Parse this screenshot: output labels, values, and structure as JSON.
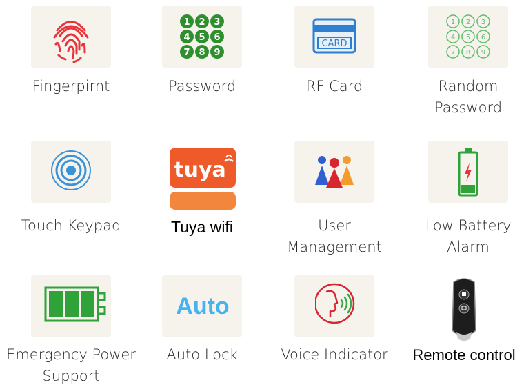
{
  "features": [
    {
      "label": "Fingerpirnt",
      "icon": "fingerprint-icon"
    },
    {
      "label": "Password",
      "icon": "number-keypad-icon",
      "digits": [
        "1",
        "2",
        "3",
        "4",
        "5",
        "6",
        "7",
        "8",
        "9"
      ]
    },
    {
      "label": "RF Card",
      "icon": "rf-card-icon",
      "card_text": "CARD"
    },
    {
      "label_line1": "Random",
      "label_line2": "Password",
      "icon": "random-keypad-icon",
      "digits": [
        "1",
        "2",
        "3",
        "4",
        "5",
        "6",
        "7",
        "8",
        "9"
      ]
    },
    {
      "label": "Touch Keypad",
      "icon": "touch-keypad-icon"
    },
    {
      "label": "Tuya wifi",
      "icon": "tuya-logo-icon",
      "logo_text": "tuya"
    },
    {
      "label_line1": "User",
      "label_line2": "Management",
      "icon": "user-group-icon"
    },
    {
      "label_line1": "Low Battery",
      "label_line2": "Alarm",
      "icon": "low-battery-icon"
    },
    {
      "label_line1": "Emergency Power",
      "label_line2": "Support",
      "icon": "emergency-battery-icon"
    },
    {
      "label": "Auto Lock",
      "icon": "auto-lock-icon",
      "logo_text": "Auto"
    },
    {
      "label": "Voice Indicator",
      "icon": "voice-indicator-icon"
    },
    {
      "label": "Remote control",
      "icon": "remote-fob-icon"
    }
  ],
  "colors": {
    "tile_bg": "#f6f2ec",
    "fingerprint_red": "#e8343a",
    "keypad_green": "#2f8f2f",
    "card_blue": "#2f7fd0",
    "touch_blue": "#3a93d8",
    "tuya_orange": "#ef5a2b",
    "battery_green": "#2fa33a",
    "auto_blue": "#45b3ee",
    "voice_red": "#d8262f"
  }
}
